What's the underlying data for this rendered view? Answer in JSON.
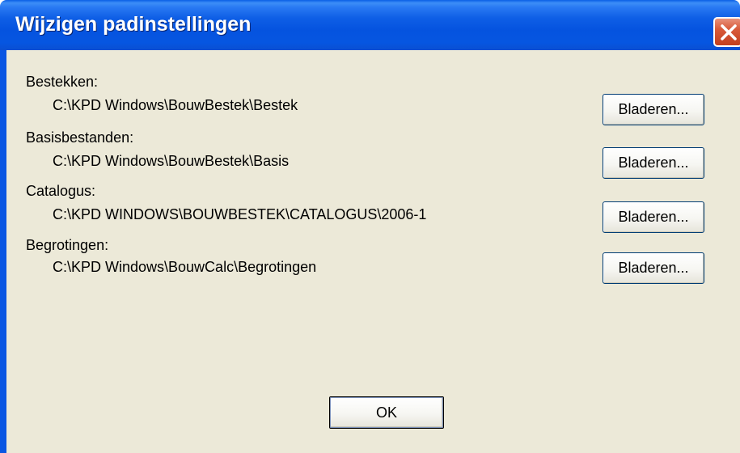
{
  "window": {
    "title": "Wijzigen padinstellingen"
  },
  "paths": [
    {
      "label": "Bestekken:",
      "value": "C:\\KPD Windows\\BouwBestek\\Bestek",
      "button_label": "Bladeren..."
    },
    {
      "label": "Basisbestanden:",
      "value": "C:\\KPD Windows\\BouwBestek\\Basis",
      "button_label": "Bladeren..."
    },
    {
      "label": "Catalogus:",
      "value": "C:\\KPD WINDOWS\\BOUWBESTEK\\CATALOGUS\\2006-1",
      "button_label": "Bladeren..."
    },
    {
      "label": "Begrotingen:",
      "value": "C:\\KPD Windows\\BouwCalc\\Begrotingen",
      "button_label": "Bladeren..."
    }
  ],
  "footer": {
    "ok_label": "OK"
  },
  "icons": {
    "close": "close-icon"
  },
  "colors": {
    "titlebar": "#0553df",
    "client_background": "#ece9d8",
    "close_button": "#d85a3a"
  }
}
